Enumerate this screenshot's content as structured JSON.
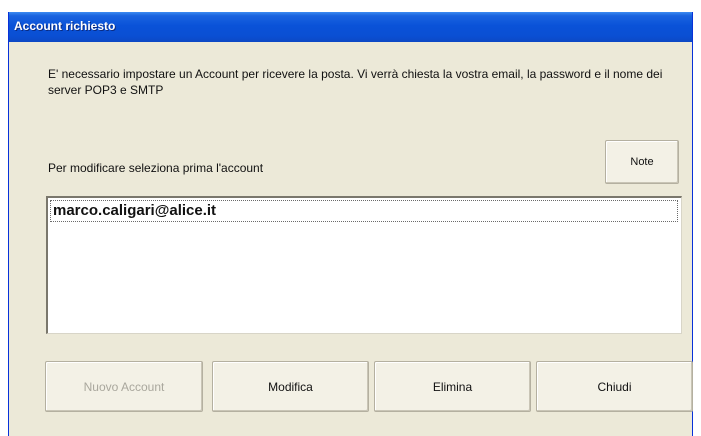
{
  "window": {
    "title": "Account richiesto"
  },
  "description": "E' necessario impostare un Account per ricevere la posta. Vi verrà chiesta la vostra email, la password e il nome dei server POP3 e SMTP",
  "instruction": "Per modificare seleziona prima l'account",
  "buttons": {
    "note": "Note",
    "new_account": "Nuovo Account",
    "edit": "Modifica",
    "delete": "Elimina",
    "close": "Chiudi"
  },
  "accounts": [
    "marco.caligari@alice.it"
  ],
  "colors": {
    "titlebar": "#0a52d8",
    "dialog_bg": "#ece9d8",
    "disabled_text": "#a9a79d"
  }
}
